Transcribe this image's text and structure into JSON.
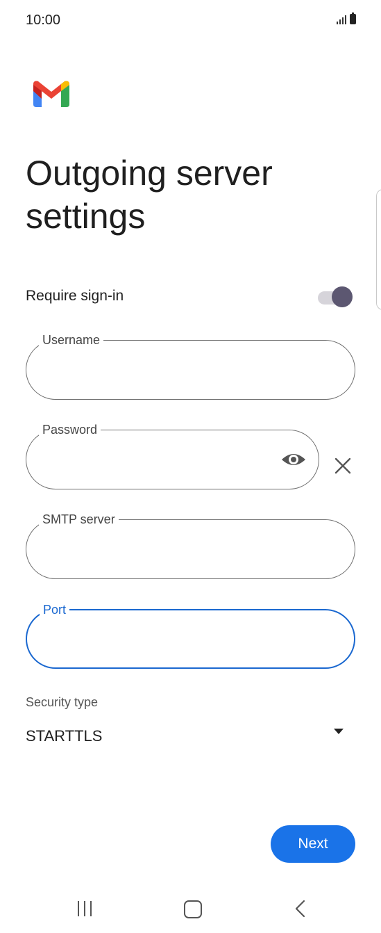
{
  "status_bar": {
    "time": "10:00"
  },
  "header": {
    "title": "Outgoing server settings"
  },
  "require_signin": {
    "label": "Require sign-in",
    "enabled": true
  },
  "fields": {
    "username": {
      "label": "Username",
      "value": ""
    },
    "password": {
      "label": "Password",
      "value": ""
    },
    "smtp_server": {
      "label": "SMTP server",
      "value": ""
    },
    "port": {
      "label": "Port",
      "value": ""
    }
  },
  "security": {
    "label": "Security type",
    "selected": "STARTTLS"
  },
  "actions": {
    "next_label": "Next"
  },
  "colors": {
    "accent": "#1a73e8",
    "focus_outline": "#1a68d0",
    "toggle_thumb": "#5c5771",
    "gmail_red": "#ea4335",
    "gmail_blue": "#4285f4",
    "gmail_green": "#34a853",
    "gmail_yellow": "#fbbc04"
  },
  "icons": {
    "logo": "gmail-logo-icon",
    "password_toggle": "eye-icon",
    "clear": "close-icon",
    "dropdown": "caret-down-icon"
  }
}
